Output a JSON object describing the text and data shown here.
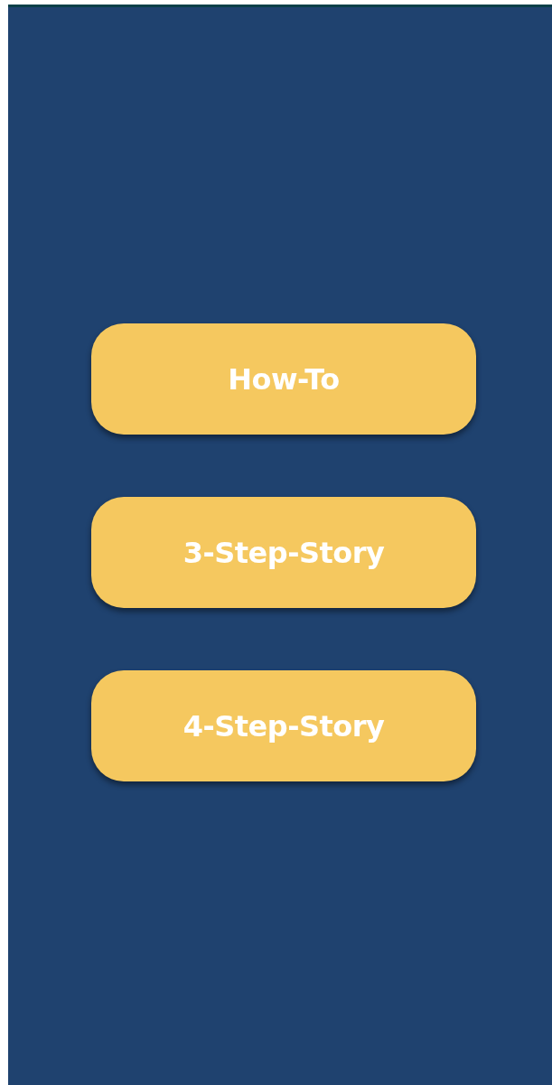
{
  "buttons": [
    {
      "label": "How-To"
    },
    {
      "label": "3-Step-Story"
    },
    {
      "label": "4-Step-Story"
    }
  ]
}
